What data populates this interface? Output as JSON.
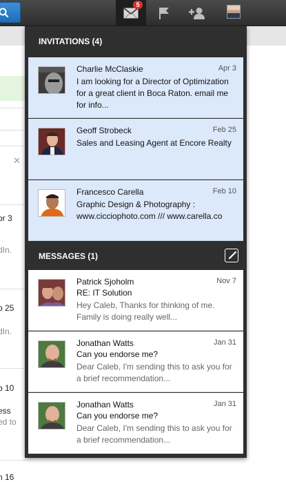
{
  "topbar": {
    "messages_badge": "5"
  },
  "background": {
    "lines": [
      "pr 3",
      "dIn.",
      "b 25",
      "dIn.",
      "b 10",
      "ess",
      "ed to",
      "n 16"
    ]
  },
  "invitations": {
    "header": "INVITATIONS (4)",
    "items": [
      {
        "name": "Charlie McClaskie",
        "date": "Apr 3",
        "text": "I am looking for a Director of Optimization for a great client in Boca Raton. email me for info..."
      },
      {
        "name": "Geoff Strobeck",
        "date": "Feb 25",
        "text": "Sales and Leasing Agent at Encore Realty"
      },
      {
        "name": "Francesco Carella",
        "date": "Feb 10",
        "text": "Graphic Design & Photography : www.cicciophoto.com /// www.carella.co"
      }
    ]
  },
  "messages": {
    "header": "MESSAGES (1)",
    "items": [
      {
        "name": "Patrick Sjoholm",
        "date": "Nov 7",
        "subject": "RE: IT Solution",
        "snippet": "Hey Caleb, Thanks for thinking of me. Family is doing really well..."
      },
      {
        "name": "Jonathan Watts",
        "date": "Jan 31",
        "subject": "Can you endorse me?",
        "snippet": "Dear Caleb, I'm sending this to ask you for a brief recommendation..."
      },
      {
        "name": "Jonathan Watts",
        "date": "Jan 31",
        "subject": "Can you endorse me?",
        "snippet": "Dear Caleb, I'm sending this to ask you for a brief recommendation..."
      }
    ]
  },
  "colors": {
    "topbar": "#3a3a3a",
    "panel": "#2f2f2f",
    "invitation_bg": "#dce9fb",
    "badge": "#d9312b",
    "search_button": "#2a7bc8"
  }
}
